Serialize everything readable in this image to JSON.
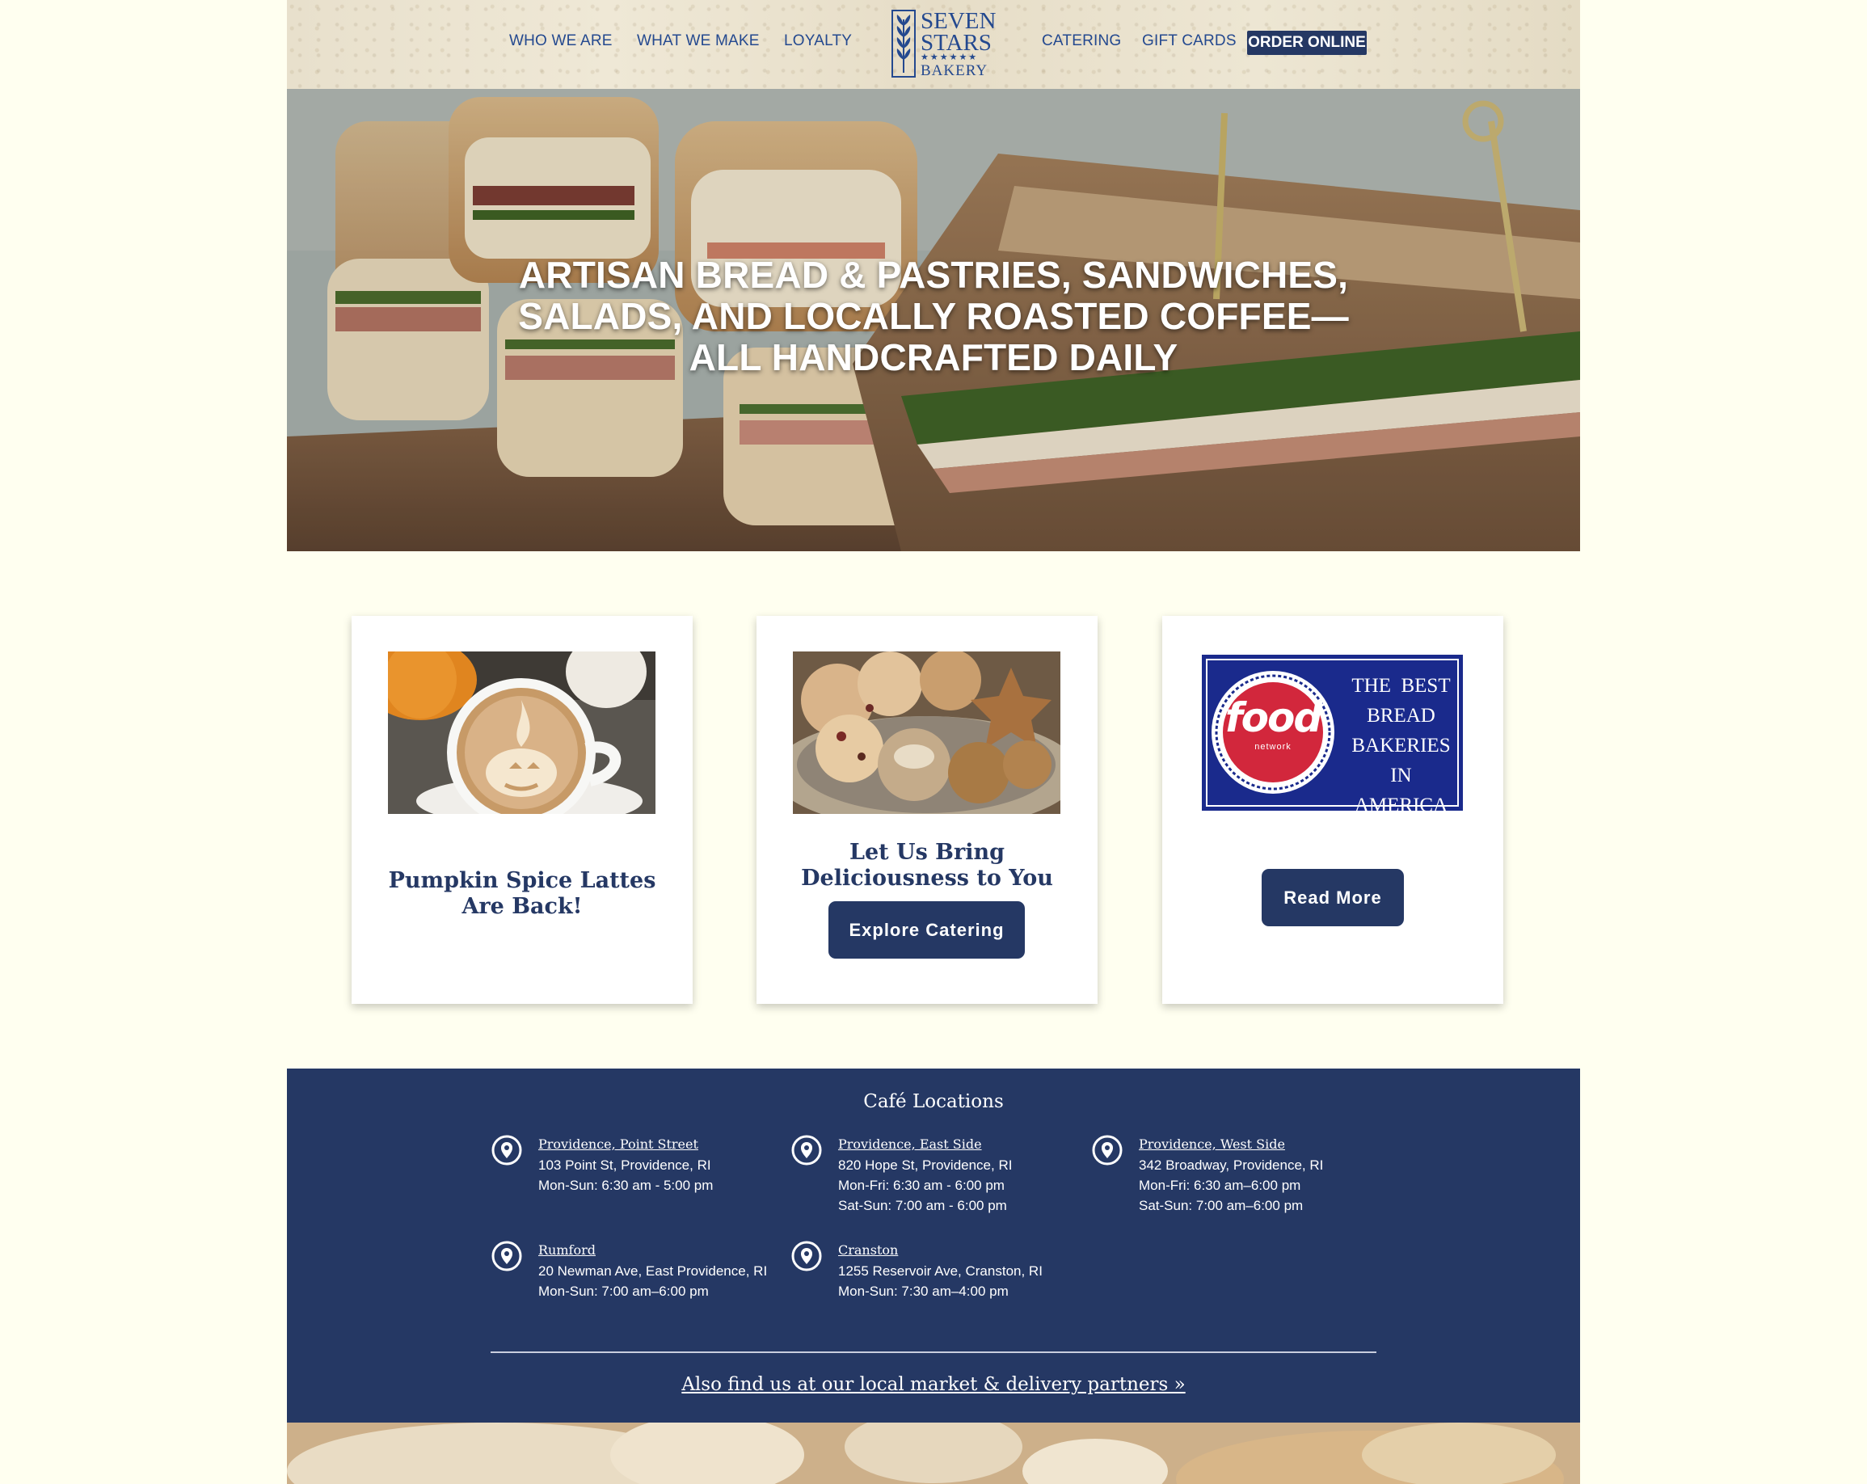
{
  "header": {
    "nav_left": [
      "WHO WE ARE",
      "WHAT WE MAKE",
      "LOYALTY"
    ],
    "nav_right": [
      "CATERING",
      "GIFT CARDS"
    ],
    "order_online": "ORDER ONLINE",
    "logo": {
      "line1": "SEVEN",
      "line2": "STARS",
      "stars": "★★★★★★",
      "line3": "BAKERY"
    }
  },
  "hero": {
    "headline_line1": "ARTISAN BREAD & PASTRIES, SANDWICHES,",
    "headline_line2": "SALADS, AND LOCALLY ROASTED COFFEE—",
    "headline_line3": "ALL HANDCRAFTED DAILY"
  },
  "cards": [
    {
      "title_line1": "Pumpkin Spice Lattes",
      "title_line2": "Are Back!",
      "button": ""
    },
    {
      "title_line1": "Let Us Bring",
      "title_line2": "Deliciousness to You",
      "button": "Explore Catering"
    },
    {
      "title_line1": "",
      "title_line2": "",
      "button": "Read More",
      "badge": {
        "brand": "food",
        "sub": "network",
        "text_lines": [
          "THE  BEST",
          "BREAD",
          "BAKERIES",
          "IN AMERICA"
        ]
      }
    }
  ],
  "locations": {
    "heading": "Café Locations",
    "items": [
      {
        "name": "Providence, Point Street",
        "address": "103 Point St, Providence, RI",
        "hours": [
          "Mon-Sun: 6:30 am - 5:00 pm"
        ]
      },
      {
        "name": "Providence, East Side",
        "address": "820 Hope St, Providence, RI",
        "hours": [
          "Mon-Fri: 6:30 am - 6:00 pm",
          "Sat-Sun: 7:00 am - 6:00 pm"
        ]
      },
      {
        "name": "Providence, West Side",
        "address": "342 Broadway, Providence, RI",
        "hours": [
          "Mon-Fri: 6:30 am–6:00 pm",
          "Sat-Sun: 7:00 am–6:00 pm"
        ]
      },
      {
        "name": "Rumford",
        "address": "20 Newman Ave, East Providence, RI",
        "hours": [
          "Mon-Sun: 7:00 am–6:00 pm"
        ]
      },
      {
        "name": "Cranston",
        "address": "1255 Reservoir Ave, Cranston, RI",
        "hours": [
          "Mon-Sun: 7:30 am–4:00 pm"
        ]
      }
    ],
    "also_find": "Also find us at our local market & delivery partners »"
  },
  "colors": {
    "navy": "#253864",
    "nav_blue": "#24498f",
    "background": "#fffff0",
    "food_network_red": "#d2273c"
  }
}
